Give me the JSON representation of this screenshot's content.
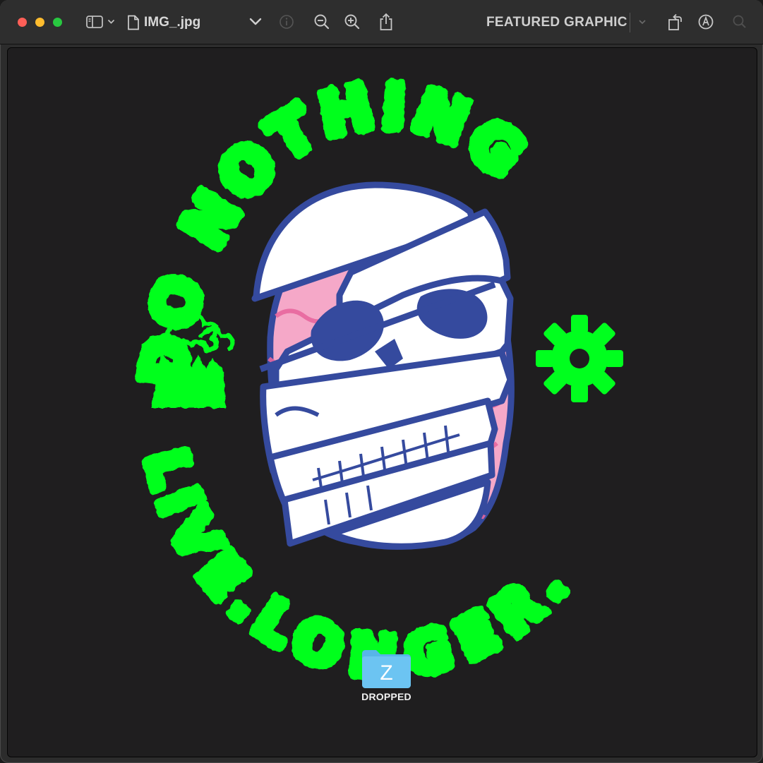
{
  "window": {
    "filename": "IMG_.jpg",
    "title_right": "FEATURED GRAPHIC"
  },
  "colors": {
    "close": "#fe5f57",
    "minimize": "#febc2e",
    "zoom": "#28c840",
    "slime_green": "#00ff1e",
    "skull_outline": "#354a9e",
    "brain_pink": "#f5a8c8",
    "brain_dark_pink": "#e8669e",
    "folder_blue": "#6cc4f2"
  },
  "artwork": {
    "top_text": "DO NOTHING",
    "bottom_text": "LIVE.LONGER."
  },
  "desktop_item": {
    "folder_letter": "Z",
    "label": "DROPPED"
  },
  "icons": [
    "sidebar-toggle-icon",
    "chevron-down-icon",
    "document-icon",
    "info-icon",
    "zoom-out-icon",
    "zoom-in-icon",
    "share-icon",
    "rotate-icon",
    "markup-icon",
    "search-icon",
    "factory-icon",
    "gear-icon"
  ]
}
